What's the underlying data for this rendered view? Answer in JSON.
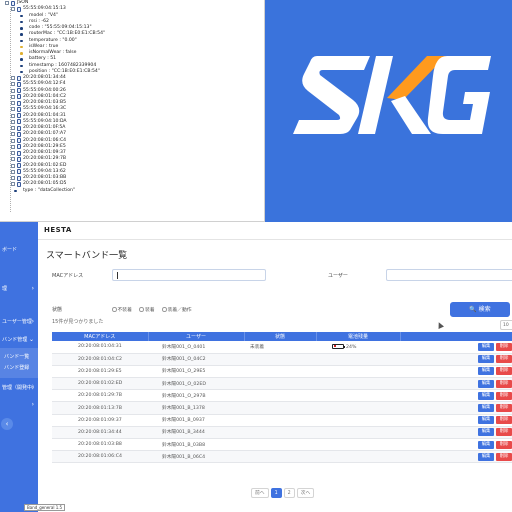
{
  "json_tree": {
    "rows": [
      {
        "indent": 0,
        "kind": "object",
        "text": "JSON"
      },
      {
        "indent": 1,
        "kind": "object",
        "text": "55:55:09:04:15:13"
      },
      {
        "indent": 2,
        "kind": "field",
        "text": "model : \"V4\""
      },
      {
        "indent": 2,
        "kind": "field",
        "text": "rssi : -62"
      },
      {
        "indent": 2,
        "kind": "field",
        "text": "code : \"55:55:09:04:15:13\""
      },
      {
        "indent": 2,
        "kind": "field",
        "text": "routerMac : \"CC:1B:E0:E1:CB:54\""
      },
      {
        "indent": 2,
        "kind": "field",
        "text": "temperature : \"0.00\""
      },
      {
        "indent": 2,
        "kind": "flag",
        "text": "isWear : true"
      },
      {
        "indent": 2,
        "kind": "flag",
        "text": "isNormalWear : false"
      },
      {
        "indent": 2,
        "kind": "field",
        "text": "battery : 51"
      },
      {
        "indent": 2,
        "kind": "field",
        "text": "timestamp : 1607482339904"
      },
      {
        "indent": 2,
        "kind": "field",
        "text": "position : \"CC:1B:E0:E1:CB:54\""
      },
      {
        "indent": 1,
        "kind": "object",
        "text": "20:20:08:01:34:44"
      },
      {
        "indent": 1,
        "kind": "object",
        "text": "55:55:09:04:12:F4"
      },
      {
        "indent": 1,
        "kind": "object",
        "text": "55:55:09:04:00:26"
      },
      {
        "indent": 1,
        "kind": "object",
        "text": "20:20:08:01:04:C2"
      },
      {
        "indent": 1,
        "kind": "object",
        "text": "20:20:08:01:03:B5"
      },
      {
        "indent": 1,
        "kind": "object",
        "text": "55:55:09:04:16:3C"
      },
      {
        "indent": 1,
        "kind": "object",
        "text": "20:20:08:01:04:31"
      },
      {
        "indent": 1,
        "kind": "object",
        "text": "55:55:09:04:10:DA"
      },
      {
        "indent": 1,
        "kind": "object",
        "text": "20:20:08:01:0F:5A"
      },
      {
        "indent": 1,
        "kind": "object",
        "text": "20:20:08:01:07:A7"
      },
      {
        "indent": 1,
        "kind": "object",
        "text": "20:20:08:01:06:C4"
      },
      {
        "indent": 1,
        "kind": "object",
        "text": "20:20:08:01:29:E5"
      },
      {
        "indent": 1,
        "kind": "object",
        "text": "20:20:08:01:09:37"
      },
      {
        "indent": 1,
        "kind": "object",
        "text": "20:20:08:01:29:7B"
      },
      {
        "indent": 1,
        "kind": "object",
        "text": "20:20:08:01:02:ED"
      },
      {
        "indent": 1,
        "kind": "object",
        "text": "55:55:09:04:13:62"
      },
      {
        "indent": 1,
        "kind": "object",
        "text": "20:20:08:01:03:BB"
      },
      {
        "indent": 1,
        "kind": "object",
        "text": "20:20:08:01:05:D5"
      },
      {
        "indent": 1,
        "kind": "field",
        "text": "type : \"dataCollection\""
      }
    ]
  },
  "logo": {
    "colors": {
      "bg": "#3a73dc",
      "white": "#ffffff",
      "orange": "#ff9a1e"
    }
  },
  "sidebar": {
    "items": [
      {
        "label": "ボード"
      },
      {
        "label": ""
      },
      {
        "label": "理",
        "chevron": "›"
      },
      {
        "label": "ユーザー管理",
        "chevron": "›"
      },
      {
        "label": "バンド管理",
        "chevron": "⌄"
      }
    ],
    "sub_items": [
      "バンド一覧",
      "バンド登録"
    ],
    "items_after": [
      {
        "label": "管理（開発中）",
        "chevron": "›"
      },
      {
        "label": "",
        "chevron": "›"
      }
    ],
    "collapse_icon": "‹"
  },
  "header": {
    "brand": "HESTA"
  },
  "main": {
    "title": "スマートバンド一覧",
    "mac_label": "MACアドレス",
    "user_label": "ユーザー",
    "status_label": "状態",
    "status_options": [
      "不装着",
      "装着",
      "装着／動作"
    ],
    "search_label": "🔍 検索",
    "found_text": "15件が見つかりました",
    "page_size": "10"
  },
  "table": {
    "headers": [
      "MACアドレス",
      "ユーザー",
      "状態",
      "電池残量",
      ""
    ],
    "edit_label": "編集",
    "delete_label": "削除",
    "rows": [
      {
        "mac": "20:20:08:01:04:31",
        "user": "鈴木陽001_O_0401",
        "status": "未装着",
        "battery": "24%",
        "battery_pct": 24
      },
      {
        "mac": "20:20:08:01:04:C2",
        "user": "鈴木陽001_O_04C2",
        "status": "",
        "battery": "",
        "battery_pct": null
      },
      {
        "mac": "20:20:08:01:29:E5",
        "user": "鈴木陽001_O_29E5",
        "status": "",
        "battery": "",
        "battery_pct": null
      },
      {
        "mac": "20:20:08:01:02:ED",
        "user": "鈴木陽001_O_02ED",
        "status": "",
        "battery": "",
        "battery_pct": null
      },
      {
        "mac": "20:20:08:01:29:7B",
        "user": "鈴木陽001_O_297B",
        "status": "",
        "battery": "",
        "battery_pct": null
      },
      {
        "mac": "20:20:08:01:13:7B",
        "user": "鈴木陽001_B_1378",
        "status": "",
        "battery": "",
        "battery_pct": null
      },
      {
        "mac": "20:20:08:01:09:37",
        "user": "鈴木陽001_B_0937",
        "status": "",
        "battery": "",
        "battery_pct": null
      },
      {
        "mac": "20:20:08:01:34:44",
        "user": "鈴木陽001_B_3444",
        "status": "",
        "battery": "",
        "battery_pct": null
      },
      {
        "mac": "20:20:08:01:03:B8",
        "user": "鈴木陽001_B_03B8",
        "status": "",
        "battery": "",
        "battery_pct": null
      },
      {
        "mac": "20:20:08:01:06:C4",
        "user": "鈴木陽001_B_06C4",
        "status": "",
        "battery": "",
        "battery_pct": null
      }
    ]
  },
  "pager": {
    "prev": "前へ",
    "pages": [
      "1",
      "2"
    ],
    "active": "1",
    "next": "次へ"
  },
  "version_tip": "Band_general 1.5"
}
